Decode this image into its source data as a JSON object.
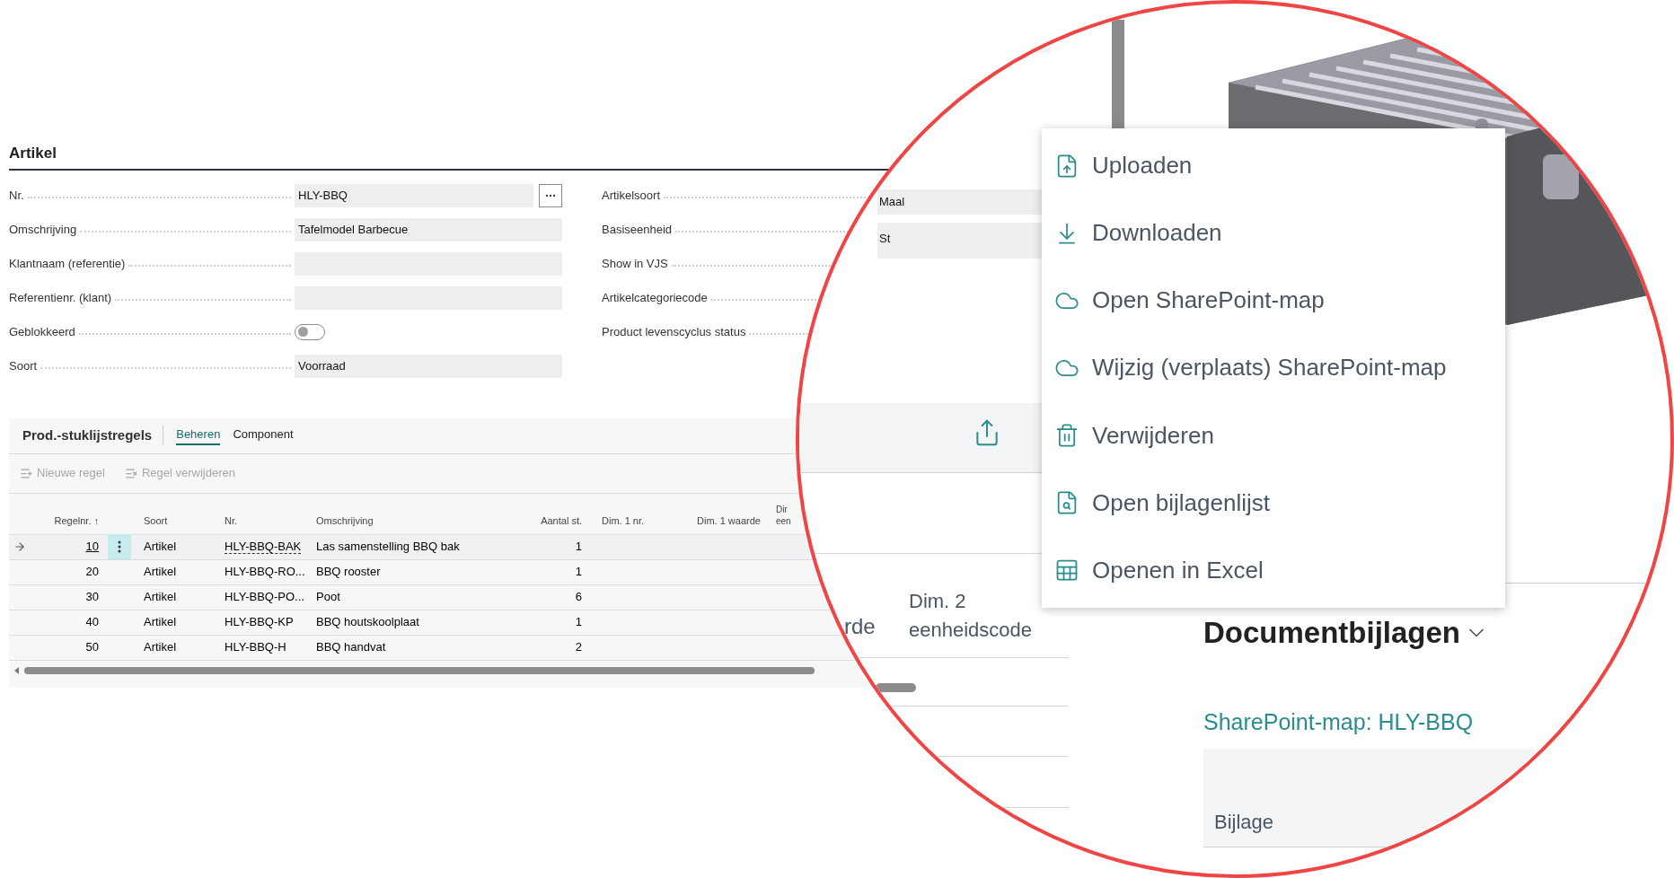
{
  "section_title": "Artikel",
  "fields_left": [
    {
      "label": "Nr.",
      "kind": "lookup",
      "value": "HLY-BBQ"
    },
    {
      "label": "Omschrijving",
      "kind": "text",
      "value": "Tafelmodel Barbecue"
    },
    {
      "label": "Klantnaam (referentie)",
      "kind": "text"
    },
    {
      "label": "Referentienr. (klant)",
      "kind": "text"
    },
    {
      "label": "Geblokkeerd",
      "kind": "toggle",
      "on": false
    },
    {
      "label": "Soort",
      "kind": "text",
      "value": "Voorraad"
    }
  ],
  "fields_right": [
    {
      "label": "Artikelsoort"
    },
    {
      "label": "Basiseenheid"
    },
    {
      "label": "Show in VJS"
    },
    {
      "label": "Artikelcategoriecode"
    },
    {
      "label": "Product levenscyclus status"
    }
  ],
  "lines_part": {
    "title": "Prod.-stuklijstregels",
    "tabs": [
      {
        "label": "Beheren",
        "selected": true
      },
      {
        "label": "Component",
        "selected": false
      }
    ],
    "actions": [
      {
        "label": "Nieuwe regel",
        "kind": "add",
        "disabled": true
      },
      {
        "label": "Regel verwijderen",
        "kind": "remove",
        "disabled": true
      }
    ],
    "columns": [
      "Regelnr. ↑",
      "Soort",
      "Nr.",
      "Omschrijving",
      "Aantal st.",
      "Dim. 1 nr.",
      "Dim. 1 waarde",
      "Dir een"
    ],
    "rows": [
      {
        "line_no": "10",
        "type": "Artikel",
        "no": "HLY-BBQ-BAK",
        "description": "Las samenstelling BBQ bak",
        "quantity": "1",
        "selected": true
      },
      {
        "line_no": "20",
        "type": "Artikel",
        "no": "HLY-BBQ-RO...",
        "description": "BBQ rooster",
        "quantity": "1",
        "selected": false
      },
      {
        "line_no": "30",
        "type": "Artikel",
        "no": "HLY-BBQ-PO...",
        "description": "Poot",
        "quantity": "6",
        "selected": false
      },
      {
        "line_no": "40",
        "type": "Artikel",
        "no": "HLY-BBQ-KP",
        "description": "BBQ houtskoolplaat",
        "quantity": "1",
        "selected": false
      },
      {
        "line_no": "50",
        "type": "Artikel",
        "no": "HLY-BBQ-H",
        "description": "BBQ handvat",
        "quantity": "2",
        "selected": false
      }
    ]
  },
  "magnifier": {
    "field_values": [
      "Maal",
      "St"
    ],
    "column_tail": "rde",
    "column_header": "Dim. 2 eenheidscode",
    "menu": [
      {
        "label": "Uploaden",
        "kind": "upload"
      },
      {
        "label": "Downloaden",
        "kind": "download"
      },
      {
        "label": "Open SharePoint-map",
        "kind": "cloud"
      },
      {
        "label": "Wijzig (verplaats) SharePoint-map",
        "kind": "cloud"
      },
      {
        "label": "Verwijderen",
        "kind": "delete"
      },
      {
        "label": "Open bijlagenlijst",
        "kind": "list"
      },
      {
        "label": "Openen in Excel",
        "kind": "excel"
      }
    ],
    "factbox": {
      "title": "Documentbijlagen",
      "link": "SharePoint-map: HLY-BBQ",
      "column": "Bijlage"
    }
  }
}
